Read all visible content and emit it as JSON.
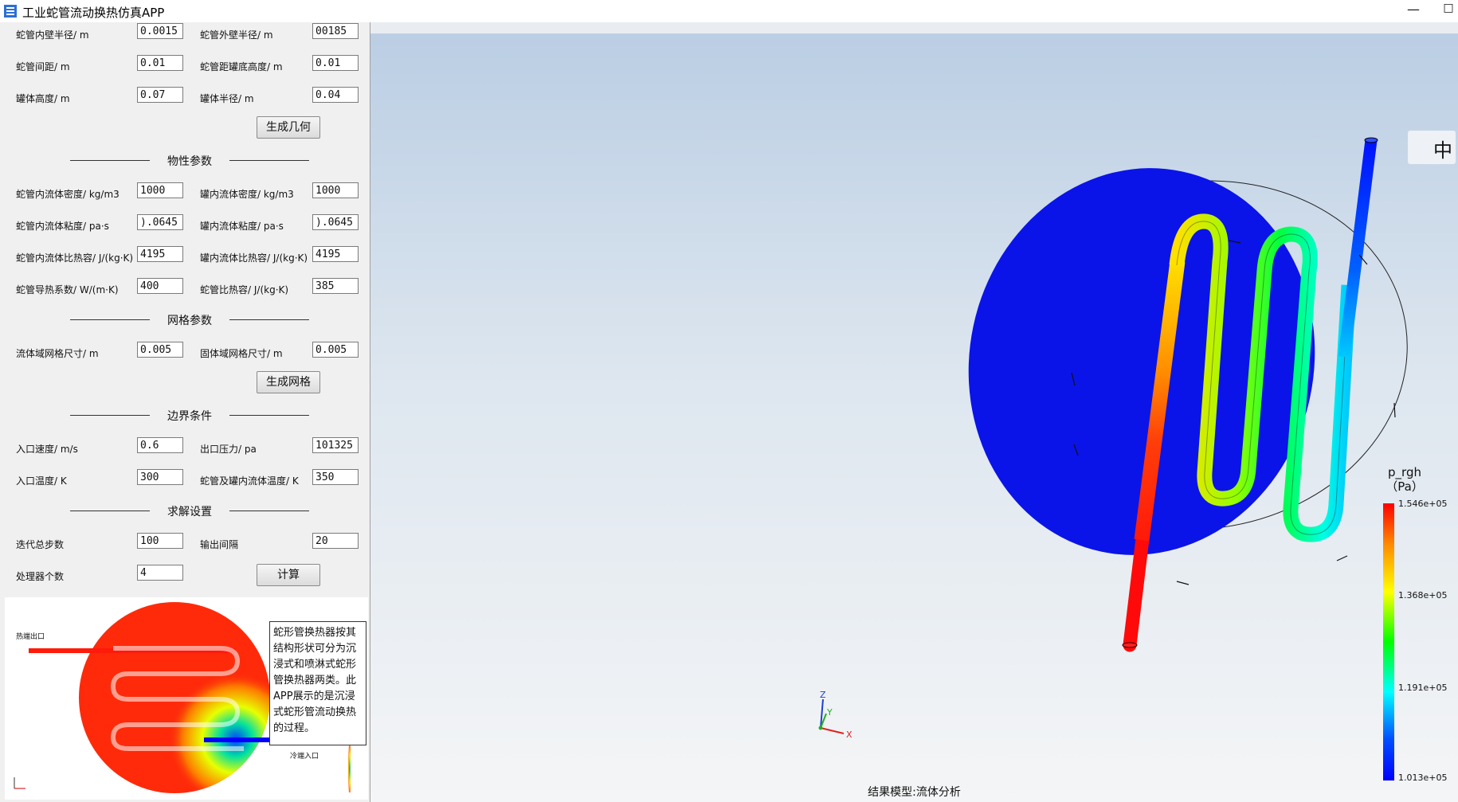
{
  "window": {
    "title": "工业蛇管流动换热仿真APP",
    "minimize_glyph": "—",
    "maximize_glyph": "□"
  },
  "params": {
    "inner_radius_label": "蛇管内壁半径/ m",
    "inner_radius_value": "0.0015",
    "outer_radius_label": "蛇管外壁半径/ m",
    "outer_radius_value": "00185",
    "spacing_label": "蛇管间距/ m",
    "spacing_value": "0.01",
    "bottom_height_label": "蛇管距罐底高度/ m",
    "bottom_height_value": "0.01",
    "tank_height_label": "罐体高度/ m",
    "tank_height_value": "0.07",
    "tank_radius_label": "罐体半径/ m",
    "tank_radius_value": "0.04",
    "gen_geometry_label": "生成几何"
  },
  "material": {
    "section_title": "物性参数",
    "tube_density_label": "蛇管内流体密度/ kg/m3",
    "tube_density_value": "1000",
    "tank_density_label": "罐内流体密度/ kg/m3",
    "tank_density_value": "1000",
    "tube_viscosity_label": "蛇管内流体粘度/ pa·s",
    "tube_viscosity_value": ").0645",
    "tank_viscosity_label": "罐内流体粘度/ pa·s",
    "tank_viscosity_value": ").0645",
    "tube_cp_label": "蛇管内流体比热容/ J/(kg·K)",
    "tube_cp_value": "4195",
    "tank_cp_label": "罐内流体比热容/ J/(kg·K)",
    "tank_cp_value": "4195",
    "tube_k_label": "蛇管导热系数/ W/(m·K)",
    "tube_k_value": "400",
    "tube_c_label": "蛇管比热容/ J/(kg·K)",
    "tube_c_value": "385"
  },
  "mesh": {
    "section_title": "网格参数",
    "fluid_mesh_label": "流体域网格尺寸/ m",
    "fluid_mesh_value": "0.005",
    "solid_mesh_label": "固体域网格尺寸/ m",
    "solid_mesh_value": "0.005",
    "gen_mesh_label": "生成网格"
  },
  "boundary": {
    "section_title": "边界条件",
    "inlet_velocity_label": "入口速度/ m/s",
    "inlet_velocity_value": "0.6",
    "outlet_pressure_label": "出口压力/ pa",
    "outlet_pressure_value": "101325",
    "inlet_temp_label": "入口温度/ K",
    "inlet_temp_value": "300",
    "tank_temp_label": "蛇管及罐内流体温度/ K",
    "tank_temp_value": "350"
  },
  "solver": {
    "section_title": "求解设置",
    "iterations_label": "迭代总步数",
    "iterations_value": "100",
    "output_interval_label": "输出间隔",
    "output_interval_value": "20",
    "processors_label": "处理器个数",
    "processors_value": "4",
    "compute_label": "计算"
  },
  "preview": {
    "hot_outlet_label": "热端出口",
    "cold_inlet_label": "冷端入口",
    "description": "蛇形管换热器按其结构形状可分为沉浸式和喷淋式蛇形管换热器两类。此APP展示的是沉浸式蛇形管流动换热的过程。"
  },
  "viewport": {
    "caption": "结果模型:流体分析",
    "ime_char": "中",
    "axes": {
      "z": "Z",
      "y": "Y",
      "x": "X"
    },
    "legend": {
      "title": "p_rgh",
      "unit": "（Pa）",
      "ticks": [
        "1.546e+05",
        "1.368e+05",
        "1.191e+05",
        "1.013e+05"
      ]
    }
  },
  "colors": {
    "tank": "#0a14e8",
    "hot": "#ff0000",
    "accent_blue": "#0000ff"
  }
}
